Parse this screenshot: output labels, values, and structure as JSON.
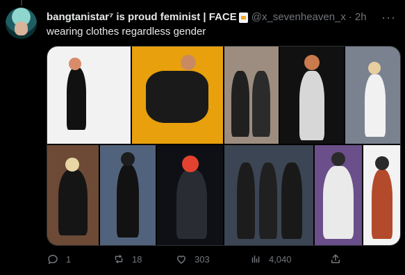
{
  "tweet": {
    "display_name": "bangtanistar⁷ is proud feminist | FACE",
    "handle": "@x_sevenheaven_x",
    "separator": "·",
    "time": "2h",
    "more": "···",
    "text": "wearing clothes regardless gender"
  },
  "actions": {
    "replies": "1",
    "retweets": "18",
    "likes": "303",
    "views": "4,040"
  },
  "icons": [
    "more-icon",
    "reply-icon",
    "retweet-icon",
    "like-icon",
    "views-icon",
    "share-icon"
  ],
  "colors": {
    "background": "#000000",
    "text": "#e7e9ea",
    "muted": "#71767b",
    "border": "#2f3336"
  }
}
